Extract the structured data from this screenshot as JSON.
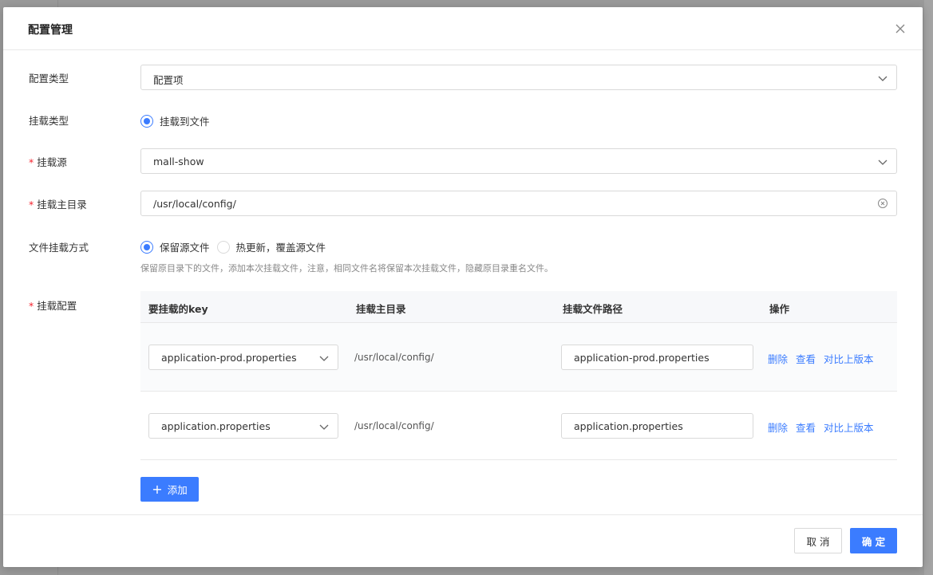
{
  "modal": {
    "title": "配置管理"
  },
  "form": {
    "config_type": {
      "label": "配置类型",
      "value": "配置项"
    },
    "mount_type": {
      "label": "挂载类型",
      "option": "挂载到文件"
    },
    "mount_source": {
      "label": "挂载源",
      "value": "mall-show"
    },
    "mount_dir": {
      "label": "挂载主目录",
      "value": "/usr/local/config/"
    },
    "file_mount_mode": {
      "label": "文件挂载方式",
      "options": [
        "保留源文件",
        "热更新，覆盖源文件"
      ],
      "selected": "保留源文件",
      "hint": "保留原目录下的文件，添加本次挂载文件，注意，相同文件名将保留本次挂载文件，隐藏原目录重名文件。"
    },
    "mount_config": {
      "label": "挂载配置",
      "columns": [
        "要挂载的key",
        "挂载主目录",
        "挂载文件路径",
        "操作"
      ],
      "rows": [
        {
          "key": "application-prod.properties",
          "dir": "/usr/local/config/",
          "path": "application-prod.properties"
        },
        {
          "key": "application.properties",
          "dir": "/usr/local/config/",
          "path": "application.properties"
        }
      ],
      "actions": [
        "删除",
        "查看",
        "对比上版本"
      ],
      "add_label": "添加"
    }
  },
  "footer": {
    "cancel_label": "取 消",
    "ok_label": "确 定"
  },
  "colors": {
    "primary": "#3b7cff",
    "required": "#f5222d"
  }
}
